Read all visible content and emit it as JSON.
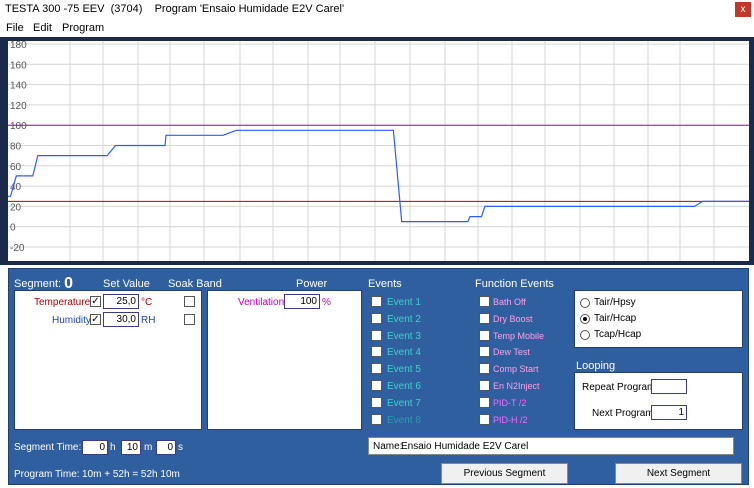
{
  "window": {
    "title": "TESTA 300 -75 EEV  (3704)    Program 'Ensaio Humidade E2V Carel'",
    "close_label": "x"
  },
  "menu": {
    "items": [
      "File",
      "Edit",
      "Program"
    ]
  },
  "colors": {
    "trace": "#2b5cff",
    "limit_high": "#b000b0",
    "limit_low": "#b00000",
    "panel": "#2f5f9e"
  },
  "chart_data": {
    "type": "line",
    "y_ticks": [
      "180",
      "160",
      "140",
      "120",
      "100",
      "80",
      "60",
      "40",
      "20",
      "0",
      "-20"
    ],
    "ylim": [
      -20,
      180
    ],
    "grid": true,
    "limit_lines": [
      100,
      25
    ],
    "series": [
      {
        "x": [
          0,
          1.5,
          5,
          15,
          18,
          60,
          65,
          95,
          95.5,
          130,
          138,
          178,
          183,
          233,
          238,
          278,
          279.4,
          286.3,
          288.3,
          373,
          375,
          415,
          420,
          448
        ],
        "y": [
          30,
          30,
          50,
          50,
          70,
          70,
          80,
          80,
          90,
          90,
          95,
          95,
          95,
          95,
          5,
          5,
          10,
          10,
          20,
          20,
          20,
          20,
          25,
          25
        ]
      }
    ]
  },
  "segment": {
    "label": "Segment:",
    "number": "0"
  },
  "headers": {
    "set_value": "Set Value",
    "soak_band": "Soak Band",
    "power": "Power",
    "events": "Events",
    "function_events": "Function Events"
  },
  "setpoints": {
    "temperature": {
      "label": "Temperature:",
      "value": "25,0",
      "unit": "°C"
    },
    "humidity": {
      "label": "Humidity:",
      "value": "30,0",
      "unit": "RH"
    }
  },
  "power": {
    "ventilation_label": "Ventilation:",
    "value": "100",
    "unit": "%"
  },
  "events": [
    "Event 1",
    "Event 2",
    "Event 3",
    "Event 4",
    "Event 5",
    "Event 6",
    "Event 7",
    "Event 8"
  ],
  "function_events": [
    "Bath Off",
    "Dry Boost",
    "Temp Mobile",
    "Dew Test",
    "Comp Start",
    "En N2Inject",
    "PID-T /2",
    "PID-H /2"
  ],
  "modes": {
    "options": [
      "Tair/Hpsy",
      "Tair/Hcap",
      "Tcap/Hcap"
    ],
    "selected": 1
  },
  "looping": {
    "title": "Looping",
    "repeat_label": "Repeat Program:",
    "repeat_value": "",
    "next_label": "Next Program:",
    "next_value": "1"
  },
  "segment_time": {
    "label": "Segment Time:",
    "h": "0",
    "h_unit": "h",
    "m": "10",
    "m_unit": "m",
    "s": "0",
    "s_unit": "s"
  },
  "program_time": {
    "label": "Program Time:",
    "value": "10m + 52h = 52h 10m"
  },
  "name_field": {
    "label": "Name:",
    "value": "Ensaio Humidade E2V Carel"
  },
  "buttons": {
    "previous": "Previous Segment",
    "next": "Next Segment"
  }
}
